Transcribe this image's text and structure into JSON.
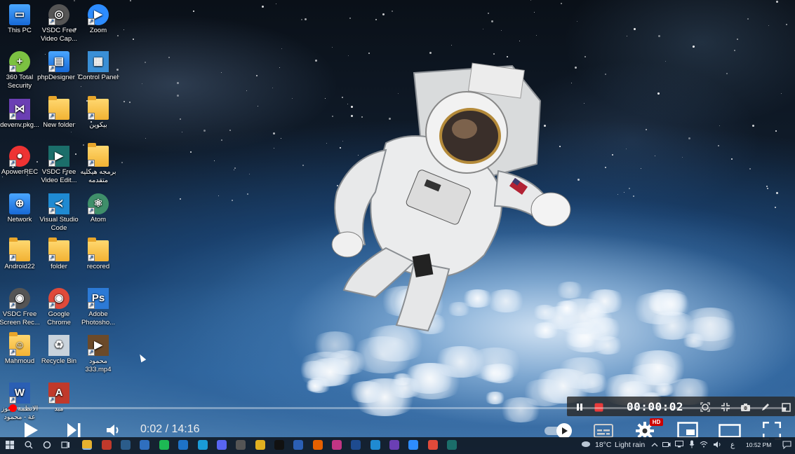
{
  "desktop": {
    "icons": [
      {
        "label": "This PC",
        "icon": "this-pc-icon"
      },
      {
        "label": "360 Total Security",
        "icon": "360-security-icon"
      },
      {
        "label": "devenv.pkg...",
        "icon": "visual-studio-icon"
      },
      {
        "label": "ApowerREC",
        "icon": "apowerrec-icon"
      },
      {
        "label": "Network",
        "icon": "network-icon"
      },
      {
        "label": "Android22",
        "icon": "folder-icon"
      },
      {
        "label": "VSDC Free Screen Rec...",
        "icon": "vsdc-screen-recorder-icon"
      },
      {
        "label": "Mahmoud",
        "icon": "user-folder-icon"
      },
      {
        "label": "الانظمة الموز عة - محمود",
        "icon": "word-document-icon"
      },
      {
        "label": "VSDC Free Video Cap...",
        "icon": "vsdc-video-capture-icon"
      },
      {
        "label": "phpDesigner 7",
        "icon": "phpdesigner-icon"
      },
      {
        "label": "New folder",
        "icon": "folder-icon"
      },
      {
        "label": "VSDC Free Video Edit...",
        "icon": "vsdc-video-editor-icon"
      },
      {
        "label": "Visual Studio Code",
        "icon": "vscode-icon"
      },
      {
        "label": "folder",
        "icon": "folder-icon"
      },
      {
        "label": "Google Chrome",
        "icon": "chrome-icon"
      },
      {
        "label": "Recycle Bin",
        "icon": "recycle-bin-icon"
      },
      {
        "label": "مبد",
        "icon": "pdf-icon"
      },
      {
        "label": "Zoom",
        "icon": "zoom-icon"
      },
      {
        "label": "Control Panel",
        "icon": "control-panel-icon"
      },
      {
        "label": "بيكوين",
        "icon": "folder-icon"
      },
      {
        "label": "برمجه هيكليه متقدمه",
        "icon": "folder-icon"
      },
      {
        "label": "Atom",
        "icon": "atom-icon"
      },
      {
        "label": "recored",
        "icon": "folder-icon"
      },
      {
        "label": "Adobe Photosho...",
        "icon": "photoshop-icon"
      },
      {
        "label": "محمود 333.mp4",
        "icon": "video-file-icon"
      }
    ]
  },
  "recorder": {
    "elapsed": "00:00:02"
  },
  "player": {
    "progress_fraction": 0.0024,
    "current_time": "0:02",
    "separator": " / ",
    "duration": "14:16",
    "quality_badge": "HD"
  },
  "taskbar": {
    "weather_temp": "18°C",
    "weather_desc": "Light rain",
    "input_language": "ع",
    "clock_time": "10:52 PM"
  },
  "colors": {
    "progress": "#ff0000",
    "quality_badge": "#cc0000",
    "taskbar": "#101a26"
  }
}
